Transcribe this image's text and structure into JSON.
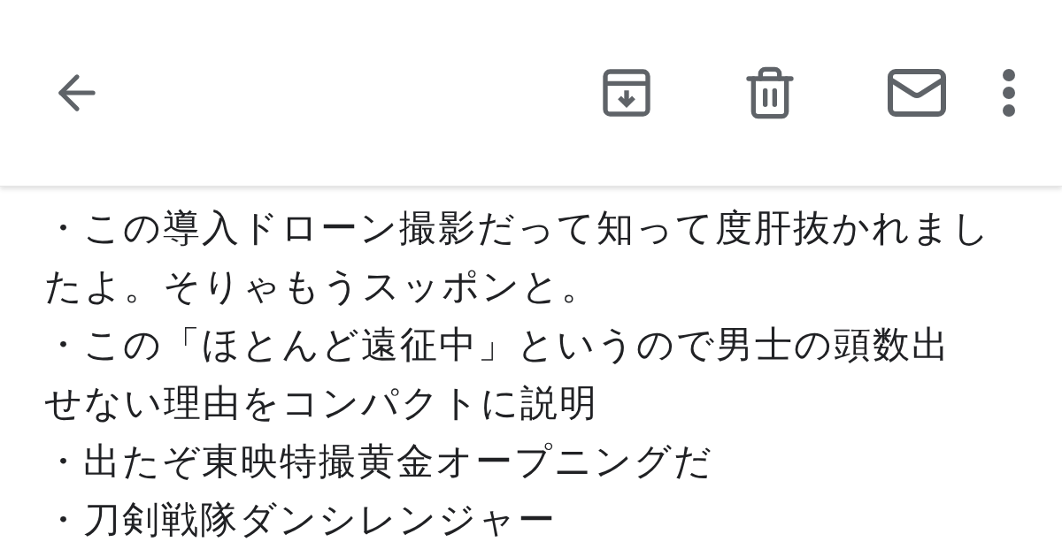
{
  "body_lines": [
    "・この導入ドローン撮影だって知って度肝抜かれまし",
    "たよ。そりゃもうスッポンと。",
    "・この「ほとんど遠征中」というので男士の頭数出",
    "せない理由をコンパクトに説明",
    "・出たぞ東映特撮黄金オープニングだ",
    "・刀剣戦隊ダンシレンジャー"
  ]
}
